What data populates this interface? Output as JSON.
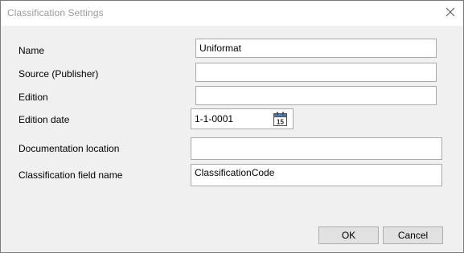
{
  "window": {
    "title": "Classification Settings",
    "close_icon": "close-icon"
  },
  "form": {
    "name": {
      "label": "Name",
      "value": "Uniformat"
    },
    "source": {
      "label": "Source (Publisher)",
      "value": ""
    },
    "edition": {
      "label": "Edition",
      "value": ""
    },
    "edition_date": {
      "label": "Edition date",
      "value": "1-1-0001",
      "calendar_icon_day": "15",
      "calendar_icon": "calendar-icon"
    },
    "documentation_location": {
      "label": "Documentation location",
      "value": ""
    },
    "classification_field_name": {
      "label": "Classification field name",
      "value": "ClassificationCode"
    }
  },
  "buttons": {
    "ok_label": "OK",
    "cancel_label": "Cancel"
  },
  "colors": {
    "title_text": "#9a9a9a",
    "dialog_background": "#f0f0f0",
    "button_background": "#e1e1e1",
    "field_border": "#a9a9a9",
    "calendar_accent": "#4a7ebb"
  }
}
